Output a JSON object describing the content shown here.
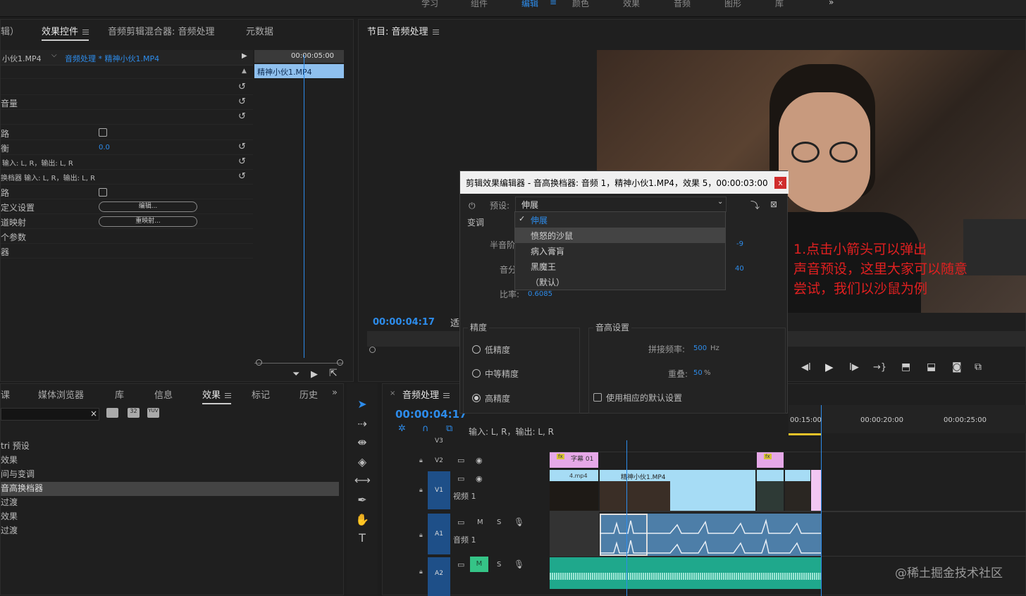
{
  "workspace_tabs": [
    "学习",
    "组件",
    "编辑",
    "颜色",
    "效果",
    "音频",
    "图形",
    "库",
    "»"
  ],
  "effect_controls": {
    "tab_partial": "辑）",
    "tabs": [
      "效果控件",
      "音频剪辑混合器: 音频处理",
      "元数据"
    ],
    "source_clip": "小伙1.MP4",
    "sequence_clip": "音频处理 * 精神小伙1.MP4",
    "timecode_top": "00:00:05:00",
    "mini_clip": "精神小伙1.MP4",
    "rows": [
      {
        "label": "音量",
        "value": ""
      },
      {
        "label": "路",
        "value": ""
      },
      {
        "label": "衡",
        "value": "0.0"
      },
      {
        "label": "输入: L, R，输出: L, R",
        "value": ""
      },
      {
        "label": "换档器 输入: L, R，输出: L, R",
        "value": ""
      },
      {
        "label": "路",
        "value": ""
      },
      {
        "label": "定义设置",
        "value": "编辑..."
      },
      {
        "label": "道映射",
        "value": "重映射..."
      },
      {
        "label": "个参数",
        "value": ""
      },
      {
        "label": "器",
        "value": ""
      }
    ]
  },
  "program_monitor": {
    "title": "节目: 音频处理",
    "timecode": "00:00:04:17",
    "fit_label": "适"
  },
  "dialog": {
    "title": "剪辑效果编辑器 - 音高换档器: 音频 1，精神小伙1.MP4，效果 5，00:00:03:00",
    "close": "x",
    "preset_label": "预设:",
    "preset_value": "伸展",
    "pitch_section": "变调",
    "semitone_label": "半音阶",
    "semitone_value": "-9",
    "cents_label": "音分",
    "cents_value": "40",
    "ratio_label": "比率:",
    "ratio_value": "0.6085",
    "dropdown_items": [
      "伸展",
      "愤怒的沙鼠",
      "病入膏肓",
      "黑魔王",
      "（默认）"
    ],
    "precision_title": "精度",
    "precision_options": [
      "低精度",
      "中等精度",
      "高精度"
    ],
    "pitch_settings_title": "音高设置",
    "splice_label": "拼接频率:",
    "splice_value": "500",
    "splice_unit": "Hz",
    "overlap_label": "重叠:",
    "overlap_value": "50",
    "overlap_unit": "%",
    "default_checkbox": "使用相应的默认设置",
    "io_text": "输入: L, R，输出: L, R"
  },
  "annotation": {
    "lines": [
      "1.点击小箭头可以弹出",
      "声音预设，这里大家可以随意",
      "尝试，我们以沙鼠为例"
    ]
  },
  "effects_panel": {
    "tabs": [
      "课",
      "媒体浏览器",
      "库",
      "信息",
      "效果",
      "标记",
      "历史",
      "»"
    ],
    "items": [
      "tri 预设",
      "效果",
      "间与变调",
      "音高换档器",
      "过渡",
      "效果",
      "过渡"
    ],
    "toolbar_icons": [
      "32",
      "YUV"
    ]
  },
  "timeline": {
    "title": "音频处理",
    "timecode": "00:00:04:17",
    "ruler_labels": [
      "00:15:00",
      "00:00:20:00",
      "00:00:25:00"
    ],
    "tracks": {
      "v3": "V3",
      "v2": "V2",
      "v1": "V1",
      "v1_name": "视频 1",
      "a1": "A1",
      "a1_name": "音频 1",
      "a2": "A2",
      "m_label": "M",
      "s_label": "S"
    },
    "clips": {
      "caption": "字幕 01",
      "clip_a": "4.mp4",
      "clip_b": "精神小伙1.MP4",
      "fx": "fx"
    }
  },
  "watermark": "@稀土掘金技术社区",
  "colors": {
    "accent": "#2d8ceb",
    "annotation": "#e02020",
    "video_clip": "#a6dcf5",
    "title_clip": "#e6a8e8",
    "audio_clip": "#4d7ea8",
    "audio2_clip": "#1fa88c",
    "track_header": "#1e4f88",
    "mute_on": "#35c487"
  }
}
